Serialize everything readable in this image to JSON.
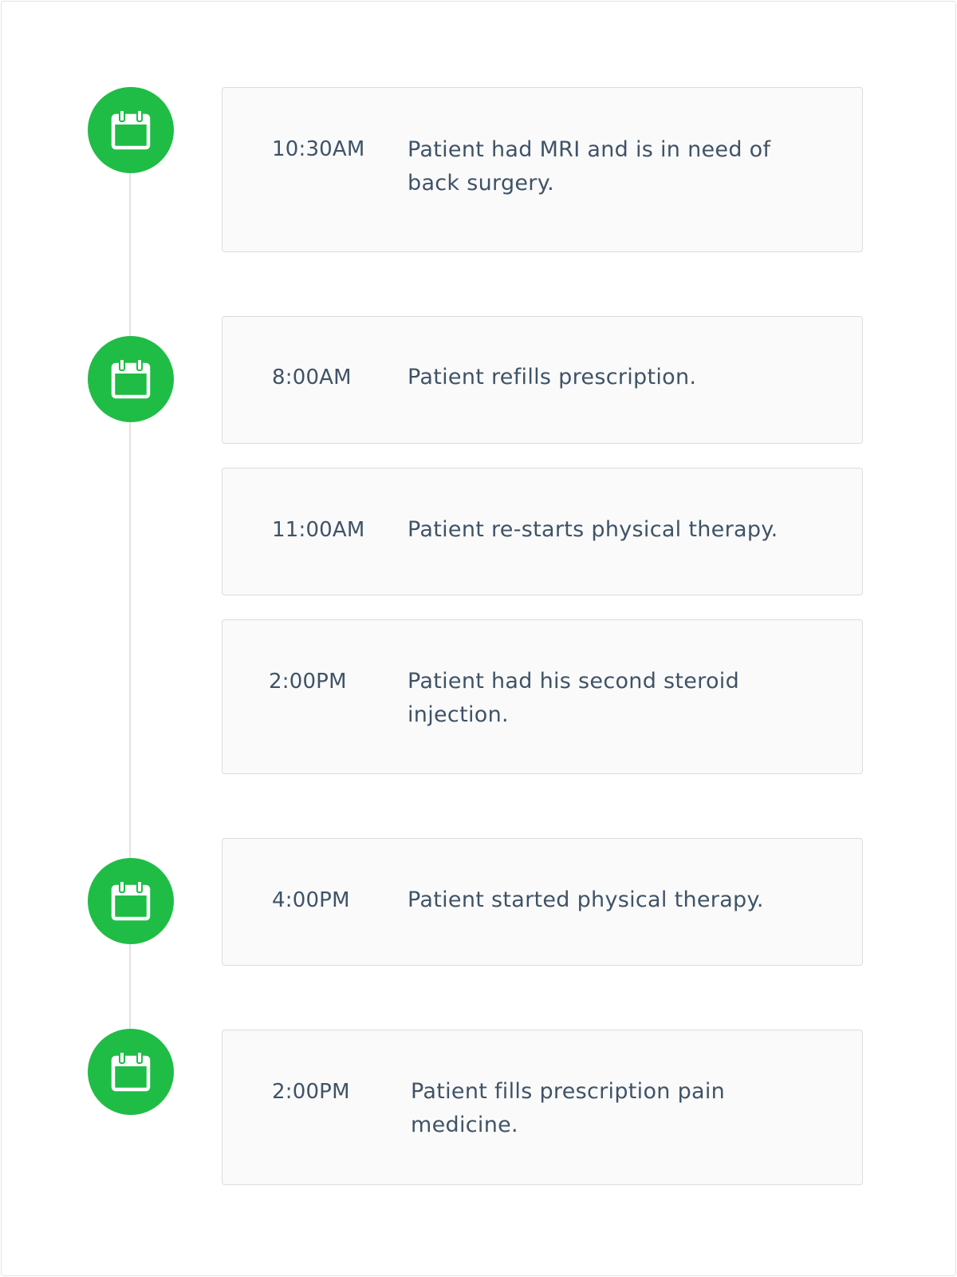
{
  "theme": {
    "accent": "#1fbd46",
    "line": "#e2e2e2",
    "card_bg": "#fafafa",
    "card_border": "#dcdcdc",
    "text": "#3f5366"
  },
  "timeline": {
    "markers": [
      {
        "icon": "calendar-icon"
      },
      {
        "icon": "calendar-icon"
      },
      {
        "icon": "calendar-icon"
      },
      {
        "icon": "calendar-icon"
      }
    ],
    "events": [
      {
        "time": "10:30AM",
        "text": "Patient had MRI and is in need of back surgery."
      },
      {
        "time": "8:00AM",
        "text": "Patient refills prescription."
      },
      {
        "time": "11:00AM",
        "text": "Patient re-starts physical therapy."
      },
      {
        "time": "2:00PM",
        "text": "Patient had his second steroid injection."
      },
      {
        "time": "4:00PM",
        "text": "Patient started physical therapy."
      },
      {
        "time": "2:00PM",
        "text": "Patient fills prescription pain medicine."
      }
    ]
  }
}
